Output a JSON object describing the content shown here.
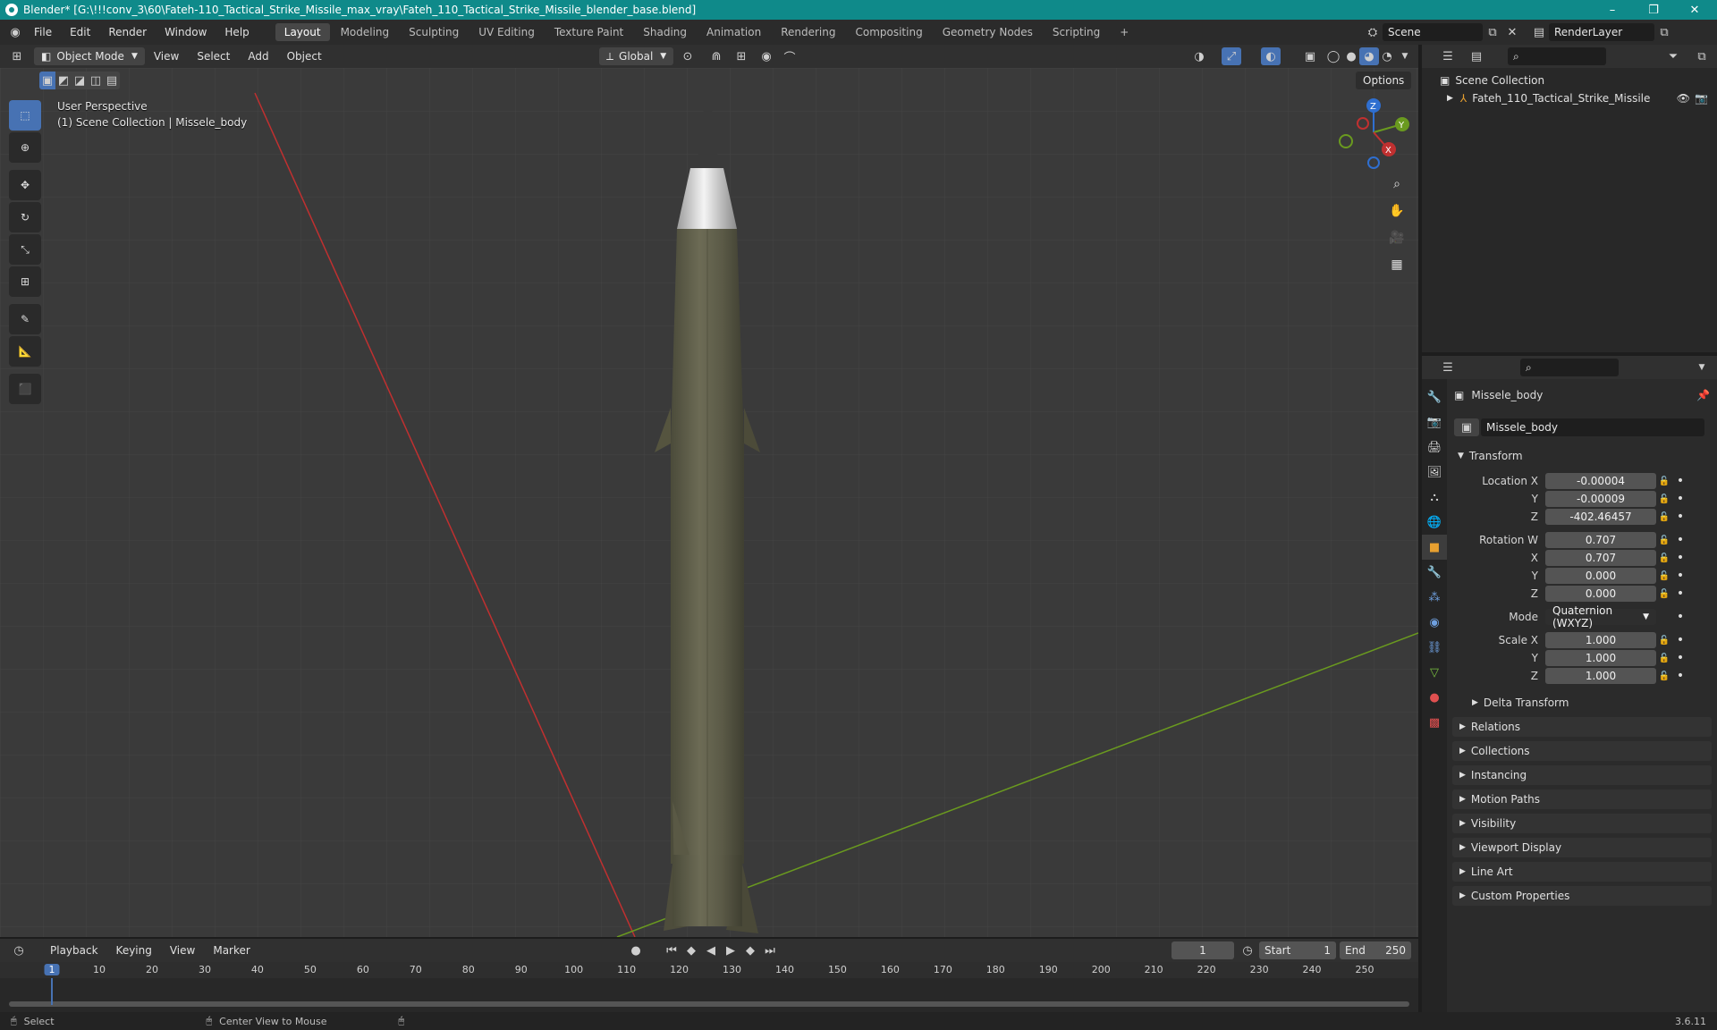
{
  "window": {
    "title": "Blender* [G:\\!!!conv_3\\60\\Fateh-110_Tactical_Strike_Missile_max_vray\\Fateh_110_Tactical_Strike_Missile_blender_base.blend]",
    "minimize": "–",
    "maximize": "❐",
    "close": "✕"
  },
  "menu": [
    "File",
    "Edit",
    "Render",
    "Window",
    "Help"
  ],
  "workspaces": [
    {
      "label": "Layout",
      "active": true
    },
    {
      "label": "Modeling"
    },
    {
      "label": "Sculpting"
    },
    {
      "label": "UV Editing"
    },
    {
      "label": "Texture Paint"
    },
    {
      "label": "Shading"
    },
    {
      "label": "Animation"
    },
    {
      "label": "Rendering"
    },
    {
      "label": "Compositing"
    },
    {
      "label": "Geometry Nodes"
    },
    {
      "label": "Scripting"
    }
  ],
  "add_workspace": "+",
  "scene": {
    "label": "Scene",
    "render_layer": "RenderLayer"
  },
  "viewport_header": {
    "mode": "Object Mode",
    "menus": [
      "View",
      "Select",
      "Add",
      "Object"
    ],
    "orientation": "Global",
    "options": "Options"
  },
  "viewport_info": {
    "line1": "User Perspective",
    "line2": "(1) Scene Collection | Missele_body"
  },
  "gizmo": {
    "x": "X",
    "y": "Y",
    "z": "Z"
  },
  "outliner": {
    "root": "Scene Collection",
    "item": "Fateh_110_Tactical_Strike_Missile"
  },
  "properties": {
    "object_name": "Missele_body",
    "data_name": "Missele_body",
    "transform_label": "Transform",
    "location": {
      "label": "Location X",
      "x": "-0.00004",
      "y": "-0.00009",
      "z": "-402.46457"
    },
    "rotation": {
      "label": "Rotation W",
      "w": "0.707",
      "x": "0.707",
      "y": "0.000",
      "z": "0.000"
    },
    "mode": {
      "label": "Mode",
      "value": "Quaternion (WXYZ)"
    },
    "scale": {
      "label": "Scale X",
      "x": "1.000",
      "y": "1.000",
      "z": "1.000"
    },
    "axis_labels": {
      "x": "X",
      "y": "Y",
      "z": "Z"
    },
    "delta_transform": "Delta Transform",
    "panels": [
      "Relations",
      "Collections",
      "Instancing",
      "Motion Paths",
      "Visibility",
      "Viewport Display",
      "Line Art",
      "Custom Properties"
    ]
  },
  "timeline": {
    "menus": [
      "Playback",
      "Keying",
      "View",
      "Marker"
    ],
    "current_frame": "1",
    "start_label": "Start",
    "start": "1",
    "end_label": "End",
    "end": "250",
    "ticks": [
      "1",
      "10",
      "20",
      "30",
      "40",
      "50",
      "60",
      "70",
      "80",
      "90",
      "100",
      "110",
      "120",
      "130",
      "140",
      "150",
      "160",
      "170",
      "180",
      "190",
      "200",
      "210",
      "220",
      "230",
      "240",
      "250"
    ]
  },
  "statusbar": {
    "select": "Select",
    "center_view": "Center View to Mouse",
    "version": "3.6.11"
  },
  "colors": {
    "title_bar": "#0f8a8a",
    "active_tool": "#4772b3",
    "x_axis": "#c03030",
    "y_axis": "#6a9a1f",
    "z_axis": "#2f6fd0"
  }
}
